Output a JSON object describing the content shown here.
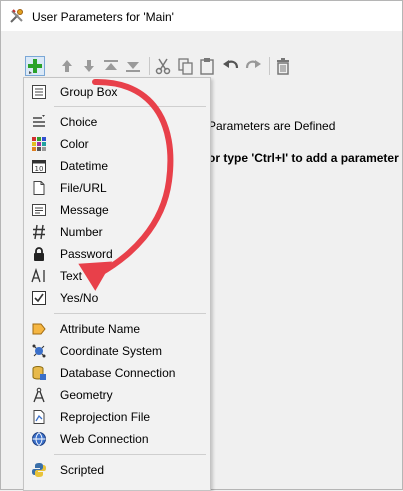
{
  "window": {
    "title": "User Parameters for 'Main'"
  },
  "content": {
    "empty_message": "Parameters are Defined",
    "hint_text": "or type 'Ctrl+I' to add a parameter"
  },
  "toolbar": {
    "buttons": [
      "add-icon",
      "arrow-up-icon",
      "arrow-down-icon",
      "move-top-icon",
      "move-bottom-icon",
      "cut-icon",
      "copy-icon",
      "paste-icon",
      "undo-icon",
      "redo-icon",
      "delete-icon"
    ]
  },
  "menu": {
    "group_box": "Group Box",
    "choice": "Choice",
    "color": "Color",
    "datetime": "Datetime",
    "file_url": "File/URL",
    "message": "Message",
    "number": "Number",
    "password": "Password",
    "text": "Text",
    "yes_no": "Yes/No",
    "attribute_name": "Attribute Name",
    "coordinate_system": "Coordinate System",
    "database_connection": "Database Connection",
    "geometry": "Geometry",
    "reprojection_file": "Reprojection File",
    "web_connection": "Web Connection",
    "scripted": "Scripted"
  },
  "colors": {
    "annotation_arrow": "#e8404a",
    "add_button_green": "#2aa22a",
    "menu_background": "#f2f2f2"
  }
}
